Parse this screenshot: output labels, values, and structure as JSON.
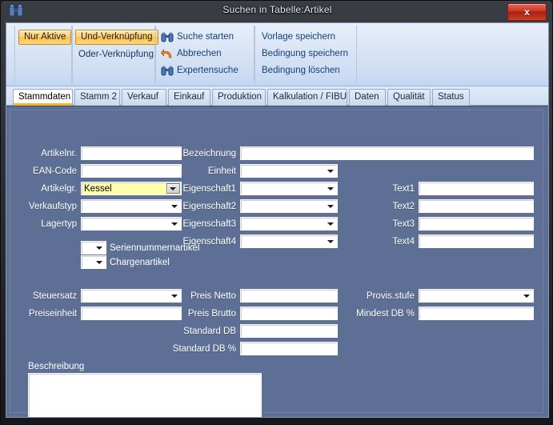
{
  "window": {
    "title": "Suchen in Tabelle:Artikel",
    "title_icon": "binoculars-icon",
    "close_label": "x"
  },
  "ribbon": {
    "groups": [
      {
        "name": "filter",
        "buttons": [
          {
            "label": "Nur Aktive",
            "state": "active"
          }
        ]
      },
      {
        "name": "verknuepfung",
        "buttons": [
          {
            "label": "Und-Verknüpfung",
            "state": "active"
          }
        ],
        "links": [
          {
            "label": "Oder-Verknüpfung"
          }
        ]
      },
      {
        "name": "suche",
        "links": [
          {
            "label": "Suche starten",
            "icon": "binoculars-icon"
          },
          {
            "label": "Abbrechen",
            "icon": "undo-arrow-icon"
          },
          {
            "label": "Expertensuche",
            "icon": "binoculars-icon"
          }
        ]
      },
      {
        "name": "vorlage",
        "links": [
          {
            "label": "Vorlage speichern"
          },
          {
            "label": "Bedingung speichern"
          },
          {
            "label": "Bedingung löschen"
          }
        ]
      }
    ]
  },
  "tabs": [
    {
      "label": "Stammdaten",
      "active": true
    },
    {
      "label": "Stamm 2",
      "active": false
    },
    {
      "label": "Verkauf",
      "active": false
    },
    {
      "label": "Einkauf",
      "active": false
    },
    {
      "label": "Produktion",
      "active": false
    },
    {
      "label": "Kalkulation / FIBU",
      "active": false
    },
    {
      "label": "Daten",
      "active": false
    },
    {
      "label": "Qualität",
      "active": false
    },
    {
      "label": "Status",
      "active": false
    }
  ],
  "form": {
    "labels": {
      "artikelnr": "Artikelnr.",
      "ean_code": "EAN-Code",
      "artikelgr": "Artikelgr.",
      "verkaufstyp": "Verkaufstyp",
      "lagertyp": "Lagertyp",
      "seriennummernartikel": "Seriennummernartikel",
      "chargenartikel": "Chargenartikel",
      "bezeichnung": "Bezeichnung",
      "einheit": "Einheit",
      "eigenschaft1": "Eigenschaft1",
      "eigenschaft2": "Eigenschaft2",
      "eigenschaft3": "Eigenschaft3",
      "eigenschaft4": "Eigenschaft4",
      "text1": "Text1",
      "text2": "Text2",
      "text3": "Text3",
      "text4": "Text4",
      "steuersatz": "Steuersatz",
      "preiseinheit": "Preiseinheit",
      "preis_netto": "Preis Netto",
      "preis_brutto": "Preis Brutto",
      "standard_db": "Standard DB",
      "standard_db_prozent": "Standard DB %",
      "provis_stufe": "Provis.stufe",
      "mindest_db_prozent": "Mindest DB %",
      "beschreibung": "Beschreibung"
    },
    "values": {
      "artikelnr": "",
      "ean_code": "",
      "artikelgr": "Kessel",
      "verkaufstyp": "",
      "lagertyp": "",
      "seriennummernartikel": "",
      "chargenartikel": "",
      "bezeichnung": "",
      "einheit": "",
      "eigenschaft1": "",
      "eigenschaft2": "",
      "eigenschaft3": "",
      "eigenschaft4": "",
      "text1": "",
      "text2": "",
      "text3": "",
      "text4": "",
      "steuersatz": "",
      "preiseinheit": "",
      "preis_netto": "",
      "preis_brutto": "",
      "standard_db": "",
      "standard_db_prozent": "",
      "provis_stufe": "",
      "mindest_db_prozent": "",
      "beschreibung": ""
    }
  },
  "colors": {
    "panel_bg": "#5d6f95",
    "accent_orange": "#fdc14c",
    "ribbon_bg": "#dce7f6",
    "highlight_yellow": "#ffffaa",
    "close_red": "#c83522"
  }
}
